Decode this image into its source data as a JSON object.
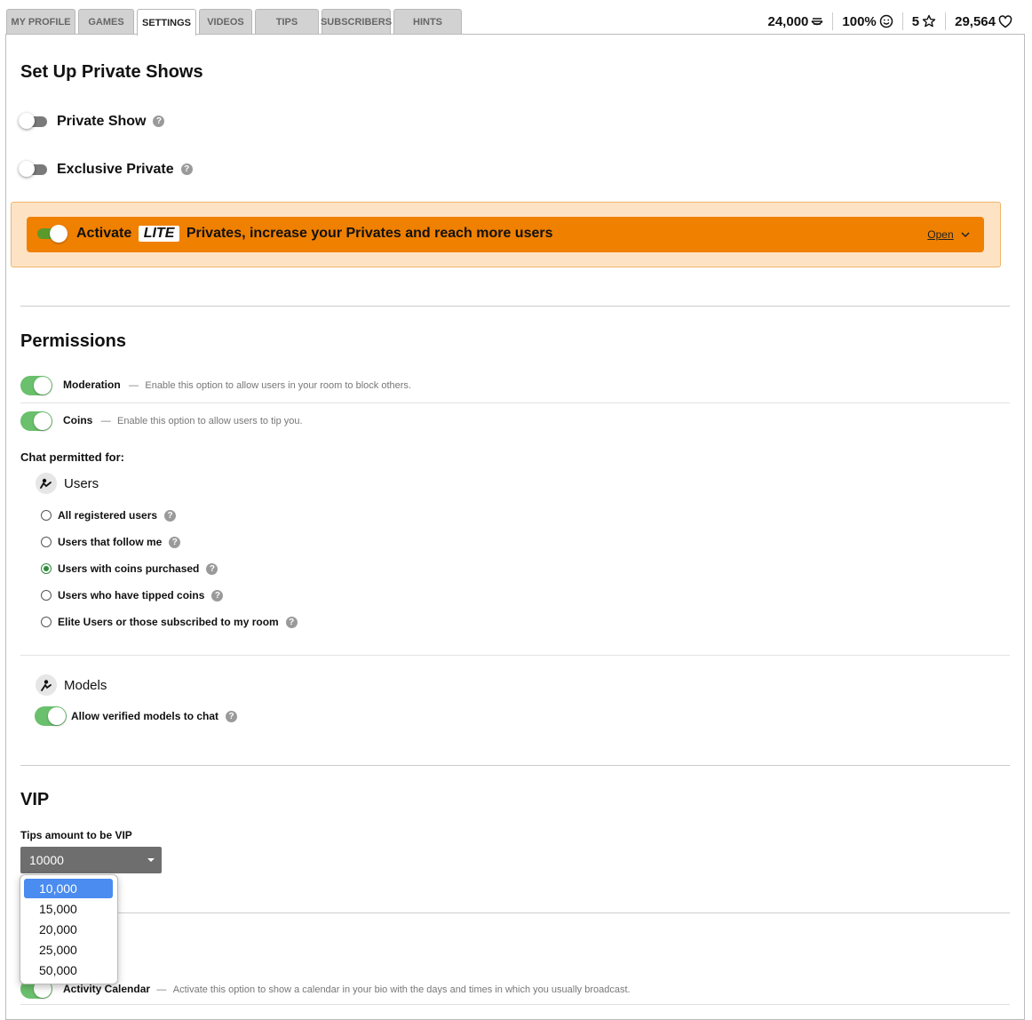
{
  "tabs": [
    {
      "label": "MY PROFILE",
      "active": false
    },
    {
      "label": "GAMES",
      "active": false
    },
    {
      "label": "SETTINGS",
      "active": true
    },
    {
      "label": "VIDEOS",
      "active": false
    },
    {
      "label": "TIPS",
      "active": false
    },
    {
      "label": "SUBSCRIBERS",
      "active": false
    },
    {
      "label": "HINTS",
      "active": false
    }
  ],
  "stats": {
    "coins": "24,000",
    "rating": "100%",
    "stars": "5",
    "likes": "29,564"
  },
  "private_shows": {
    "title": "Set Up Private Shows",
    "private_show_label": "Private Show",
    "exclusive_private_label": "Exclusive Private",
    "lite_prefix": "Activate",
    "lite_badge": "LITE",
    "lite_suffix": "Privates, increase your Privates and reach more users",
    "lite_open": "Open",
    "help": "?"
  },
  "permissions": {
    "title": "Permissions",
    "moderation_title": "Moderation",
    "moderation_desc": "Enable this option to allow users in your room to block others.",
    "coins_title": "Coins",
    "coins_desc": "Enable this option to allow users to tip you.",
    "dash": "—",
    "chat_permitted": "Chat permitted for:",
    "users_label": "Users",
    "radio_options": [
      {
        "label": "All registered users",
        "selected": false
      },
      {
        "label": "Users that follow me",
        "selected": false
      },
      {
        "label": "Users with coins purchased",
        "selected": true
      },
      {
        "label": "Users who have tipped coins",
        "selected": false
      },
      {
        "label": "Elite Users or those subscribed to my room",
        "selected": false
      }
    ],
    "models_label": "Models",
    "allow_models": "Allow verified models to chat"
  },
  "vip": {
    "title": "VIP",
    "tips_label": "Tips amount to be VIP",
    "selected_value": "10000",
    "options": [
      "10,000",
      "15,000",
      "20,000",
      "25,000",
      "50,000"
    ]
  },
  "calendar": {
    "title": "Activity Calendar",
    "desc": "Activate this option to show a calendar in your bio with the days and times in which you usually broadcast."
  },
  "colors": {
    "accent_orange": "#f08000",
    "toggle_green": "#6ac06c",
    "radio_green": "#2f8a3c",
    "dropdown_highlight": "#4a8cf0"
  }
}
